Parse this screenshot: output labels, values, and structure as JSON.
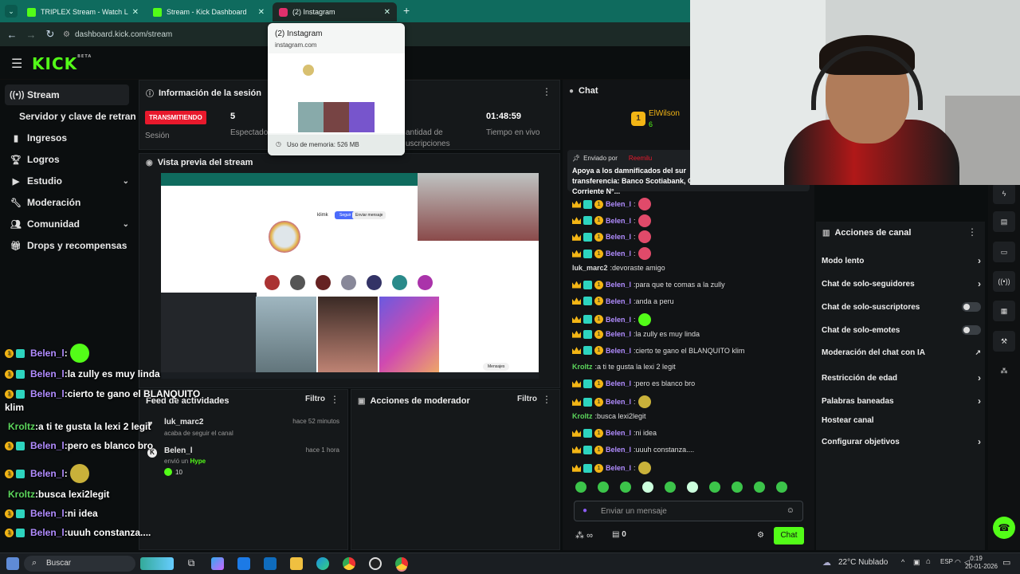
{
  "browser": {
    "tabs": [
      {
        "title": "TRIPLEX Stream - Watch Live on",
        "active": false
      },
      {
        "title": "Stream - Kick Dashboard",
        "active": false
      },
      {
        "title": "(2) Instagram",
        "active": true
      }
    ],
    "new_tab": "+",
    "url": "dashboard.kick.com/stream"
  },
  "tab_hover": {
    "title": "(2) Instagram",
    "domain": "instagram.com",
    "memory": "Uso de memoria: 526 MB"
  },
  "kick": {
    "logo": "KICK",
    "beta": "BETA"
  },
  "sidebar": {
    "items": [
      {
        "label": "Stream",
        "icon": "broadcast-icon",
        "active": true
      },
      {
        "label": "Servidor y clave de retransm",
        "icon": "",
        "active": false
      },
      {
        "label": "Ingresos",
        "icon": "chart-icon",
        "active": false
      },
      {
        "label": "Logros",
        "icon": "trophy-icon",
        "active": false
      },
      {
        "label": "Estudio",
        "icon": "video-icon",
        "active": false,
        "expandable": true
      },
      {
        "label": "Moderación",
        "icon": "wrench-icon",
        "active": false
      },
      {
        "label": "Comunidad",
        "icon": "users-icon",
        "active": false,
        "expandable": true
      },
      {
        "label": "Drops y recompensas",
        "icon": "gift-icon",
        "active": false
      }
    ]
  },
  "session": {
    "title": "Información de la sesión",
    "status": "TRANSMITIENDO",
    "status_label": "Sesión",
    "viewers_value": "5",
    "viewers_label": "Espectador",
    "subs_label_1": "antidad de",
    "subs_label_2": "uscripciones",
    "time_value": "01:48:59",
    "time_label": "Tiempo en vivo"
  },
  "preview": {
    "title": "Vista previa del stream",
    "ig_user": "klimk",
    "ig_follow": "Seguir",
    "ig_message": "Enviar mensaje",
    "ig_messages_label": "Mensajes"
  },
  "activity": {
    "title": "Feed de actividades",
    "filter": "Filtro",
    "items": [
      {
        "user": "luk_marc2",
        "time": "hace 52 minutos",
        "desc": "acaba de seguir el canal"
      },
      {
        "user": "Belen_l",
        "time": "hace 1 hora",
        "desc_prefix": "envió un",
        "desc_highlight": "Hype",
        "amount": "10"
      }
    ]
  },
  "modactions": {
    "title": "Acciones de moderador",
    "filter": "Filtro"
  },
  "chat": {
    "title": "Chat",
    "top_user": "ElWilson",
    "top_user_count": "6",
    "pinned_by_label": "Enviado por",
    "pinned_by_user": "Reemilu",
    "pinned_text": "Apoya a los damnificados del sur transferencia: Banco Scotiabank, Cuenta Corriente N°...",
    "messages": [
      {
        "user": "Belen_l",
        "text": "",
        "badges": true,
        "emote": "heart"
      },
      {
        "user": "Belen_l",
        "text": "",
        "badges": true,
        "emote": "heart"
      },
      {
        "user": "Belen_l",
        "text": "",
        "badges": true,
        "emote": "heart"
      },
      {
        "user": "Belen_l",
        "text": "",
        "badges": true,
        "emote": "heart"
      },
      {
        "user": "luk_marc2",
        "text": "devoraste amigo",
        "badges": false,
        "emote": ""
      },
      {
        "user": "Belen_l",
        "text": "para que te comas a la zully",
        "badges": true,
        "emote": ""
      },
      {
        "user": "Belen_l",
        "text": "anda a peru",
        "badges": true,
        "emote": ""
      },
      {
        "user": "Belen_l",
        "text": "",
        "badges": true,
        "emote": "green"
      },
      {
        "user": "Belen_l",
        "text": "la zully es muy linda",
        "badges": true,
        "emote": ""
      },
      {
        "user": "Belen_l",
        "text": "cierto te gano el BLANQUITO klim",
        "badges": true,
        "emote": ""
      },
      {
        "user": "Kroltz",
        "text": "a ti te gusta la lexi 2 legit",
        "badges": false,
        "emote": ""
      },
      {
        "user": "Belen_l",
        "text": "pero es blanco bro",
        "badges": true,
        "emote": ""
      },
      {
        "user": "Belen_l",
        "text": "",
        "badges": true,
        "emote": "gold"
      },
      {
        "user": "Kroltz",
        "text": "busca lexi2legit",
        "badges": false,
        "emote": ""
      },
      {
        "user": "Belen_l",
        "text": "ni idea",
        "badges": true,
        "emote": ""
      },
      {
        "user": "Belen_l",
        "text": "uuuh constanza....",
        "badges": true,
        "emote": ""
      },
      {
        "user": "Belen_l",
        "text": "",
        "badges": true,
        "emote": "gold"
      }
    ],
    "input_placeholder": "Enviar un mensaje",
    "points": "∞",
    "gift_count": "0",
    "send": "Chat",
    "colors": {
      "belen": "#b18cff",
      "kroltz": "#5cd65c",
      "luk": "#dddddd",
      "send_bg": "#53fc18"
    }
  },
  "channel_actions": {
    "title": "Acciones de canal",
    "rows": [
      {
        "label": "Modo lento",
        "control": "chevron"
      },
      {
        "label": "Chat de solo-seguidores",
        "control": "chevron"
      },
      {
        "label": "Chat de solo-suscriptores",
        "control": "toggle"
      },
      {
        "label": "Chat de solo-emotes",
        "control": "toggle"
      },
      {
        "label": "Moderación del chat con IA",
        "control": "external"
      },
      {
        "label": "Restricción de edad",
        "control": "chevron"
      },
      {
        "label": "Palabras baneadas",
        "control": "chevron"
      },
      {
        "label": "Hostear canal",
        "control": "none"
      },
      {
        "label": "Configurar objetivos",
        "control": "chevron"
      }
    ]
  },
  "overlay_chat": [
    {
      "user": "Belen_l",
      "text": "",
      "badges": true
    },
    {
      "user": "Belen_l",
      "text": "la zully es muy linda",
      "badges": true
    },
    {
      "user": "Belen_l",
      "text": "cierto te gano el BLANQUITO",
      "badges": true
    },
    {
      "user": "",
      "text": "klim",
      "badges": false
    },
    {
      "user": "Kroltz",
      "text": "a ti te gusta la lexi 2 legit",
      "badges": false
    },
    {
      "user": "Belen_l",
      "text": "pero es blanco bro",
      "badges": true
    },
    {
      "user": "Belen_l",
      "text": "",
      "badges": true
    },
    {
      "user": "Kroltz",
      "text": "busca lexi2legit",
      "badges": false
    },
    {
      "user": "Belen_l",
      "text": "ni idea",
      "badges": true
    },
    {
      "user": "Belen_l",
      "text": "uuuh constanza....",
      "badges": true
    }
  ],
  "taskbar": {
    "search": "Buscar",
    "weather": "22°C  Nublado",
    "lang": "ESP",
    "time": "0:19",
    "date": "20-01-2026"
  }
}
